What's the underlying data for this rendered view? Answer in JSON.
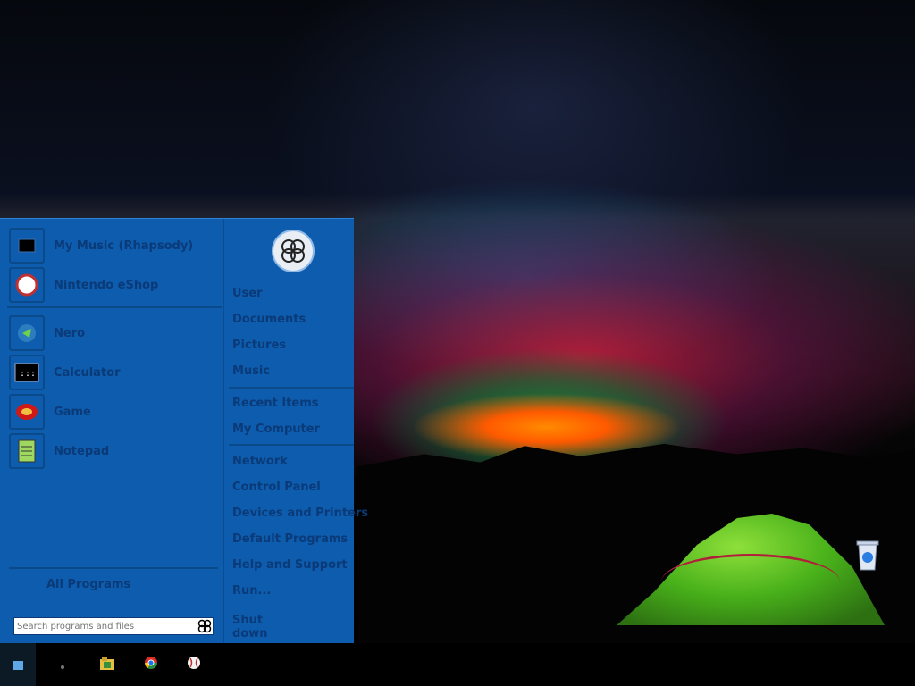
{
  "desktop": {
    "recycle_bin_icon": "recycle-bin-icon"
  },
  "start_menu": {
    "pinned": [
      {
        "label": "My Music (Rhapsody)",
        "icon": "media-player-icon"
      },
      {
        "label": "Nintendo eShop",
        "icon": "baseball-icon"
      },
      {
        "label": "Nero",
        "icon": "multimedia-icon"
      },
      {
        "label": "Calculator",
        "icon": "calculator-icon"
      },
      {
        "label": "Game",
        "icon": "game-icon"
      },
      {
        "label": "Notepad",
        "icon": "notepad-icon"
      }
    ],
    "all_programs": "All Programs",
    "search_placeholder": "Search programs and files",
    "places_group1": [
      "User",
      "Documents",
      "Pictures",
      "Music"
    ],
    "places_group2": [
      "Recent Items",
      "My Computer"
    ],
    "places_group3": [
      "Network",
      "Control Panel",
      "Devices and Printers",
      "Default Programs",
      "Help and Support",
      "Run..."
    ],
    "shutdown": "Shut down"
  },
  "taskbar": {
    "items": [
      "start-icon",
      "pin-icon",
      "file-explorer-icon",
      "chrome-icon",
      "baseball-icon"
    ]
  },
  "colors": {
    "menu_bg": "#0e5cad",
    "menu_text": "#0a3a78"
  }
}
